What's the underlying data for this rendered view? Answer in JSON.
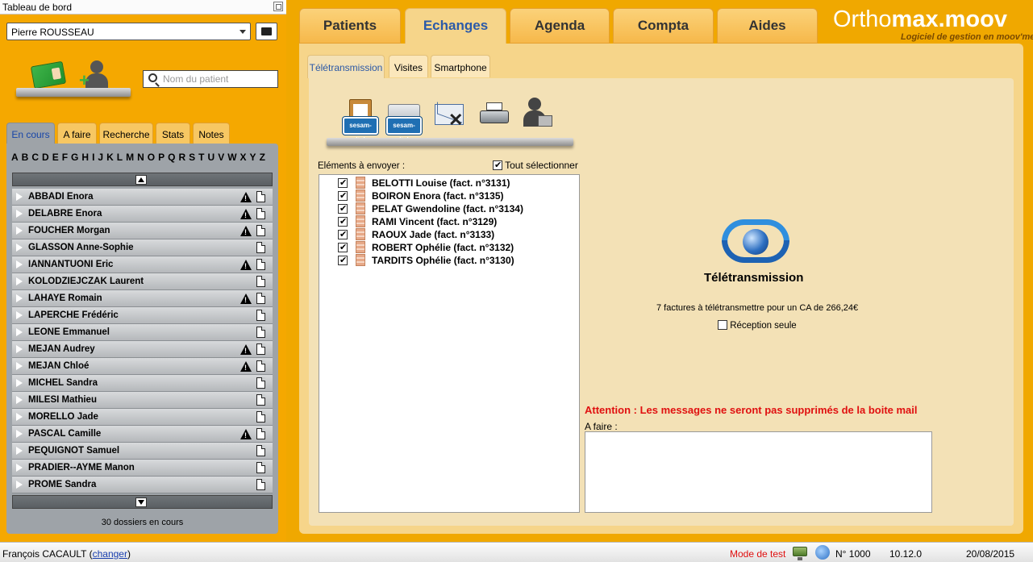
{
  "sidebar": {
    "window_title": "Tableau de bord",
    "user": "Pierre ROUSSEAU",
    "search_placeholder": "Nom du patient",
    "tabs": [
      "En cours",
      "A faire",
      "Recherche",
      "Stats",
      "Notes"
    ],
    "alphabet": [
      "A",
      "B",
      "C",
      "D",
      "E",
      "F",
      "G",
      "H",
      "I",
      "J",
      "K",
      "L",
      "M",
      "N",
      "O",
      "P",
      "Q",
      "R",
      "S",
      "T",
      "U",
      "V",
      "W",
      "X",
      "Y",
      "Z"
    ],
    "patients": [
      {
        "name": "ABBADI Enora",
        "warning": true
      },
      {
        "name": "DELABRE Enora",
        "warning": true
      },
      {
        "name": "FOUCHER Morgan",
        "warning": true
      },
      {
        "name": "GLASSON Anne-Sophie",
        "warning": false
      },
      {
        "name": "IANNANTUONI Eric",
        "warning": true
      },
      {
        "name": "KOLODZIEJCZAK Laurent",
        "warning": false
      },
      {
        "name": "LAHAYE Romain",
        "warning": true
      },
      {
        "name": "LAPERCHE Frédéric",
        "warning": false
      },
      {
        "name": "LEONE Emmanuel",
        "warning": false
      },
      {
        "name": "MEJAN Audrey",
        "warning": true
      },
      {
        "name": "MEJAN Chloé",
        "warning": true
      },
      {
        "name": "MICHEL Sandra",
        "warning": false
      },
      {
        "name": "MILESI Mathieu",
        "warning": false
      },
      {
        "name": "MORELLO Jade",
        "warning": false
      },
      {
        "name": "PASCAL Camille",
        "warning": true
      },
      {
        "name": "PEQUIGNOT Samuel",
        "warning": false
      },
      {
        "name": "PRADIER--AYME Manon",
        "warning": false
      },
      {
        "name": "PROME Sandra",
        "warning": false
      }
    ],
    "count_text": "30 dossiers en cours"
  },
  "main_tabs": [
    "Patients",
    "Echanges",
    "Agenda",
    "Compta",
    "Aides"
  ],
  "logo": {
    "part1": "Ortho",
    "part2": "max.moov",
    "subtitle": "Logiciel de gestion en moov'ment"
  },
  "sub_tabs": [
    "Télétransmission",
    "Visites",
    "Smartphone"
  ],
  "teletrans": {
    "elements_label": "Eléments à envoyer :",
    "select_all_label": "Tout sélectionner",
    "invoices": [
      "BELOTTI Louise (fact. n°3131)",
      "BOIRON Enora (fact. n°3135)",
      "PELAT Gwendoline (fact. n°3134)",
      "RAMI Vincent (fact. n°3129)",
      "RAOUX Jade (fact. n°3133)",
      "ROBERT Ophélie (fact. n°3132)",
      "TARDITS Ophélie (fact. n°3130)"
    ],
    "title": "Télétransmission",
    "info": "7 factures à télétransmettre pour un CA de 266,24€",
    "reception_label": "Réception seule",
    "warning": "Attention : Les messages ne seront pas supprimés de la boite mail",
    "todo_label": "A faire :",
    "sesam_label": "sesam-vitale"
  },
  "status": {
    "user": "François CACAULT",
    "change_link": "changer",
    "mode": "Mode de test",
    "number": "N° 1000",
    "version": "10.12.0",
    "date": "20/08/2015"
  },
  "colors": {
    "accent_blue": "#2c5aa8",
    "warning_red": "#e01010",
    "orange_bg": "#f5a800"
  }
}
